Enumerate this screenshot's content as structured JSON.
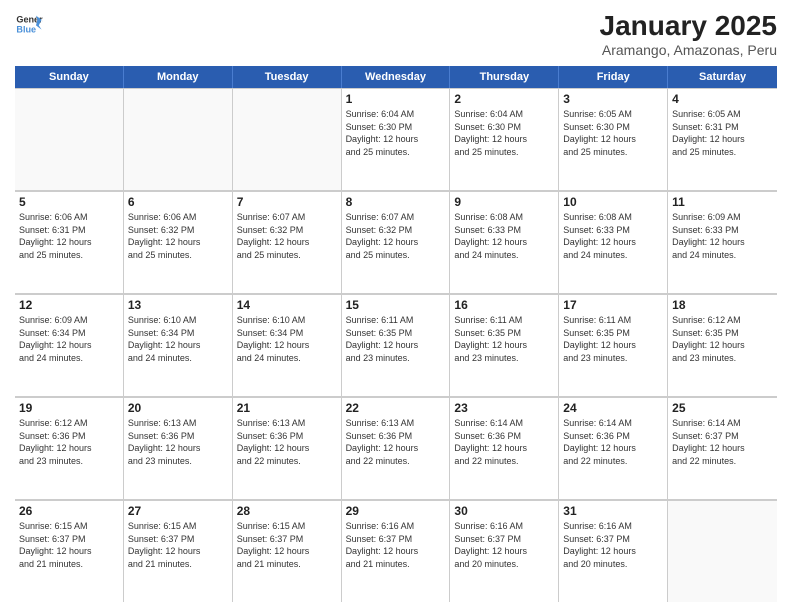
{
  "logo": {
    "line1": "General",
    "line2": "Blue"
  },
  "header": {
    "month": "January 2025",
    "location": "Aramango, Amazonas, Peru"
  },
  "weekdays": [
    "Sunday",
    "Monday",
    "Tuesday",
    "Wednesday",
    "Thursday",
    "Friday",
    "Saturday"
  ],
  "weeks": [
    [
      {
        "day": "",
        "info": ""
      },
      {
        "day": "",
        "info": ""
      },
      {
        "day": "",
        "info": ""
      },
      {
        "day": "1",
        "info": "Sunrise: 6:04 AM\nSunset: 6:30 PM\nDaylight: 12 hours\nand 25 minutes."
      },
      {
        "day": "2",
        "info": "Sunrise: 6:04 AM\nSunset: 6:30 PM\nDaylight: 12 hours\nand 25 minutes."
      },
      {
        "day": "3",
        "info": "Sunrise: 6:05 AM\nSunset: 6:30 PM\nDaylight: 12 hours\nand 25 minutes."
      },
      {
        "day": "4",
        "info": "Sunrise: 6:05 AM\nSunset: 6:31 PM\nDaylight: 12 hours\nand 25 minutes."
      }
    ],
    [
      {
        "day": "5",
        "info": "Sunrise: 6:06 AM\nSunset: 6:31 PM\nDaylight: 12 hours\nand 25 minutes."
      },
      {
        "day": "6",
        "info": "Sunrise: 6:06 AM\nSunset: 6:32 PM\nDaylight: 12 hours\nand 25 minutes."
      },
      {
        "day": "7",
        "info": "Sunrise: 6:07 AM\nSunset: 6:32 PM\nDaylight: 12 hours\nand 25 minutes."
      },
      {
        "day": "8",
        "info": "Sunrise: 6:07 AM\nSunset: 6:32 PM\nDaylight: 12 hours\nand 25 minutes."
      },
      {
        "day": "9",
        "info": "Sunrise: 6:08 AM\nSunset: 6:33 PM\nDaylight: 12 hours\nand 24 minutes."
      },
      {
        "day": "10",
        "info": "Sunrise: 6:08 AM\nSunset: 6:33 PM\nDaylight: 12 hours\nand 24 minutes."
      },
      {
        "day": "11",
        "info": "Sunrise: 6:09 AM\nSunset: 6:33 PM\nDaylight: 12 hours\nand 24 minutes."
      }
    ],
    [
      {
        "day": "12",
        "info": "Sunrise: 6:09 AM\nSunset: 6:34 PM\nDaylight: 12 hours\nand 24 minutes."
      },
      {
        "day": "13",
        "info": "Sunrise: 6:10 AM\nSunset: 6:34 PM\nDaylight: 12 hours\nand 24 minutes."
      },
      {
        "day": "14",
        "info": "Sunrise: 6:10 AM\nSunset: 6:34 PM\nDaylight: 12 hours\nand 24 minutes."
      },
      {
        "day": "15",
        "info": "Sunrise: 6:11 AM\nSunset: 6:35 PM\nDaylight: 12 hours\nand 23 minutes."
      },
      {
        "day": "16",
        "info": "Sunrise: 6:11 AM\nSunset: 6:35 PM\nDaylight: 12 hours\nand 23 minutes."
      },
      {
        "day": "17",
        "info": "Sunrise: 6:11 AM\nSunset: 6:35 PM\nDaylight: 12 hours\nand 23 minutes."
      },
      {
        "day": "18",
        "info": "Sunrise: 6:12 AM\nSunset: 6:35 PM\nDaylight: 12 hours\nand 23 minutes."
      }
    ],
    [
      {
        "day": "19",
        "info": "Sunrise: 6:12 AM\nSunset: 6:36 PM\nDaylight: 12 hours\nand 23 minutes."
      },
      {
        "day": "20",
        "info": "Sunrise: 6:13 AM\nSunset: 6:36 PM\nDaylight: 12 hours\nand 23 minutes."
      },
      {
        "day": "21",
        "info": "Sunrise: 6:13 AM\nSunset: 6:36 PM\nDaylight: 12 hours\nand 22 minutes."
      },
      {
        "day": "22",
        "info": "Sunrise: 6:13 AM\nSunset: 6:36 PM\nDaylight: 12 hours\nand 22 minutes."
      },
      {
        "day": "23",
        "info": "Sunrise: 6:14 AM\nSunset: 6:36 PM\nDaylight: 12 hours\nand 22 minutes."
      },
      {
        "day": "24",
        "info": "Sunrise: 6:14 AM\nSunset: 6:36 PM\nDaylight: 12 hours\nand 22 minutes."
      },
      {
        "day": "25",
        "info": "Sunrise: 6:14 AM\nSunset: 6:37 PM\nDaylight: 12 hours\nand 22 minutes."
      }
    ],
    [
      {
        "day": "26",
        "info": "Sunrise: 6:15 AM\nSunset: 6:37 PM\nDaylight: 12 hours\nand 21 minutes."
      },
      {
        "day": "27",
        "info": "Sunrise: 6:15 AM\nSunset: 6:37 PM\nDaylight: 12 hours\nand 21 minutes."
      },
      {
        "day": "28",
        "info": "Sunrise: 6:15 AM\nSunset: 6:37 PM\nDaylight: 12 hours\nand 21 minutes."
      },
      {
        "day": "29",
        "info": "Sunrise: 6:16 AM\nSunset: 6:37 PM\nDaylight: 12 hours\nand 21 minutes."
      },
      {
        "day": "30",
        "info": "Sunrise: 6:16 AM\nSunset: 6:37 PM\nDaylight: 12 hours\nand 20 minutes."
      },
      {
        "day": "31",
        "info": "Sunrise: 6:16 AM\nSunset: 6:37 PM\nDaylight: 12 hours\nand 20 minutes."
      },
      {
        "day": "",
        "info": ""
      }
    ]
  ]
}
